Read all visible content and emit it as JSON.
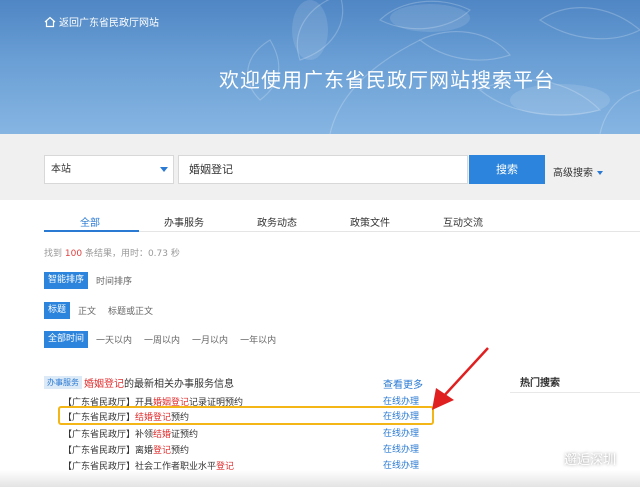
{
  "header": {
    "back_label": "返回广东省民政厅网站",
    "title": "欢迎使用广东省民政厅网站搜索平台"
  },
  "search": {
    "scope": "本站",
    "query": "婚姻登记",
    "button": "搜索",
    "advanced": "高级搜索"
  },
  "tabs": [
    {
      "label": "全部"
    },
    {
      "label": "办事服务"
    },
    {
      "label": "政务动态"
    },
    {
      "label": "政策文件"
    },
    {
      "label": "互动交流"
    }
  ],
  "result_count": {
    "prefix": "找到",
    "count": "100",
    "suffix": "条结果，用时：0.73 秒"
  },
  "sort": {
    "smart": "智能排序",
    "time": "时间排序"
  },
  "field_filter": {
    "title": "标题",
    "body": "正文",
    "title_or_body": "标题或正文"
  },
  "time_filter": {
    "all": "全部时间",
    "day": "一天以内",
    "week": "一周以内",
    "month": "一月以内",
    "year": "一年以内"
  },
  "service": {
    "badge": "办事服务",
    "heading_keyword": "婚姻登记",
    "heading_rest": "的最新相关办事服务信息",
    "see_more": "查看更多",
    "items": [
      {
        "pre": "【广东省民政厅】开具",
        "hl": "婚姻登记",
        "post": "记录证明预约",
        "action": "在线办理"
      },
      {
        "pre": "【广东省民政厅】",
        "hl": "结婚登记",
        "post": "预约",
        "action": "在线办理"
      },
      {
        "pre": "【广东省民政厅】补领",
        "hl": "结婚",
        "post": "证预约",
        "action": "在线办理"
      },
      {
        "pre": "【广东省民政厅】离婚",
        "hl": "登记",
        "post": "预约",
        "action": "在线办理"
      },
      {
        "pre": "【广东省民政厅】社会工作者职业水平",
        "hl": "登记",
        "post": "",
        "action": "在线办理"
      }
    ]
  },
  "hot_search": {
    "title": "热门搜索"
  },
  "watermark": {
    "text": "邂逅深圳"
  },
  "colors": {
    "accent": "#2c84dc",
    "highlight_text": "#e03030",
    "annotation": "#f3b616",
    "arrow": "#e02020"
  }
}
